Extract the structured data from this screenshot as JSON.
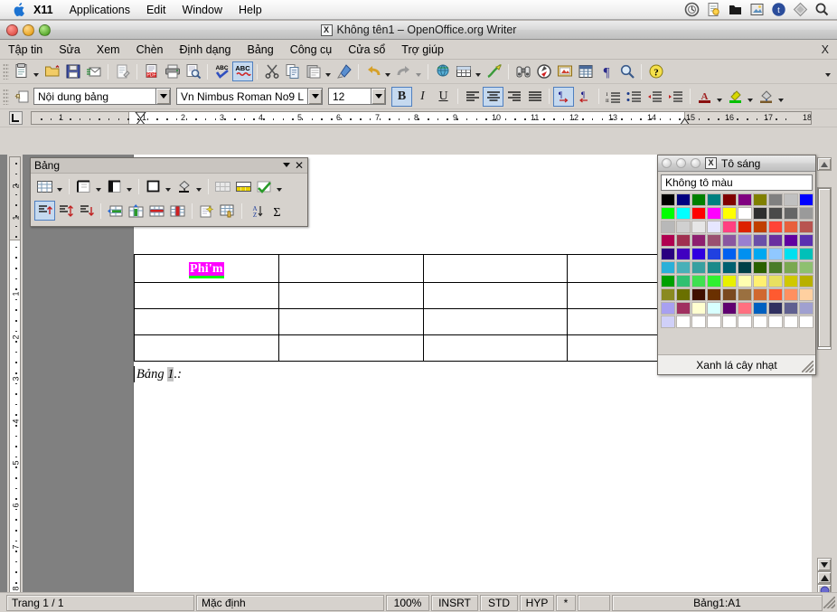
{
  "os_menu": {
    "apple_icon": "apple-logo",
    "items": [
      {
        "label": "X11",
        "bold": true
      },
      {
        "label": "Applications",
        "bold": false
      },
      {
        "label": "Edit",
        "bold": false
      },
      {
        "label": "Window",
        "bold": false
      },
      {
        "label": "Help",
        "bold": false
      }
    ],
    "tray_icons": [
      "timemachine-icon",
      "document-preview-icon",
      "black-folder-icon",
      "screenshot-icon",
      "twitter-icon",
      "diamond-icon",
      "spotlight-icon"
    ]
  },
  "window": {
    "title": "Không tên1 – OpenOffice.org Writer",
    "x_badge": "X",
    "close_label": "X"
  },
  "menubar": {
    "items": [
      {
        "label": "Tập tin",
        "accel": "T"
      },
      {
        "label": "Sửa",
        "accel": "S"
      },
      {
        "label": "Xem",
        "accel": "X"
      },
      {
        "label": "Chèn",
        "accel": "C"
      },
      {
        "label": "Định dạng",
        "accel": "a"
      },
      {
        "label": "Bảng",
        "accel": "g"
      },
      {
        "label": "Công cụ",
        "accel": "C"
      },
      {
        "label": "Cửa sổ",
        "accel": "s"
      },
      {
        "label": "Trợ giúp",
        "accel": "u"
      }
    ]
  },
  "standard_toolbar": {
    "buttons": [
      "new-document-icon",
      "new-dropdown-icon",
      "open-folder-icon",
      "save-icon",
      "email-document-icon",
      "edit-file-icon",
      "export-pdf-icon",
      "print-icon",
      "print-preview-icon",
      "spellcheck-icon",
      "autospellcheck-icon",
      "cut-scissors-icon",
      "copy-icon",
      "paste-icon",
      "paste-dropdown-icon",
      "clone-formatting-brush-icon",
      "undo-icon",
      "undo-dropdown-icon",
      "redo-icon",
      "redo-dropdown-icon",
      "hyperlink-globe-icon",
      "insert-table-icon",
      "insert-table-dropdown-icon",
      "draw-line-icon",
      "find-replace-binoculars-icon",
      "navigator-compass-icon",
      "gallery-picture-icon",
      "data-sources-icon",
      "formatting-marks-pilcrow-icon",
      "zoom-magnifier-icon",
      "help-question-icon",
      "toolbar-overflow-icon"
    ]
  },
  "formatting_toolbar": {
    "style_value": "Nội dung bảng",
    "font_value": "Vn Nimbus Roman No9 L",
    "size_value": "12",
    "apply_style_icon": "apply-style-icon",
    "bold_label": "B",
    "italic_label": "I",
    "underline_label": "U",
    "bold_active": true,
    "align_center_active": true,
    "ltr_active": true,
    "buttons": [
      "align-left-icon",
      "align-center-icon",
      "align-right-icon",
      "justify-icon",
      "ltr-text-direction-icon",
      "rtl-text-direction-icon",
      "ordered-list-icon",
      "unordered-list-icon",
      "decrease-indent-icon",
      "increase-indent-icon",
      "font-color-icon",
      "font-color-dropdown-icon",
      "highlighting-icon",
      "highlighting-dropdown-icon",
      "background-color-icon",
      "background-color-dropdown-icon"
    ]
  },
  "ruler_h": {
    "labels": [
      "1",
      "1",
      "2",
      "3",
      "4",
      "5",
      "6",
      "7",
      "8",
      "9",
      "10",
      "11",
      "12",
      "13",
      "14",
      "15",
      "16",
      "17",
      "18"
    ]
  },
  "ruler_v": {
    "labels": [
      "2",
      "1",
      "1",
      "2",
      "3",
      "4",
      "5",
      "6",
      "7",
      "8"
    ]
  },
  "table_toolbar": {
    "title": "Bảng",
    "dropdown_icon": "chevron-down-icon",
    "close_icon": "close-icon",
    "row1": [
      "insert-table-icon",
      "insert-table-dropdown-icon",
      "line-style-icon",
      "line-style-dropdown-icon",
      "line-color-icon",
      "line-color-dropdown-icon",
      "borders-icon",
      "borders-dropdown-icon",
      "background-color-icon",
      "background-color-dropdown-icon",
      "merge-cells-icon",
      "split-cells-icon",
      "optimize-icon",
      "optimize-dropdown-icon"
    ],
    "row2": [
      "align-top-icon",
      "align-center-vertical-icon",
      "align-bottom-icon",
      "insert-row-icon",
      "insert-column-icon",
      "delete-row-icon",
      "delete-column-icon",
      "autoformat-icon",
      "table-properties-icon",
      "sort-az-icon",
      "sum-sigma-icon"
    ],
    "active_button": "align-top-icon"
  },
  "color_picker": {
    "title": "Tô sáng",
    "x_badge": "X",
    "no_fill_label": "Không tô màu",
    "selected_color_name": "Xanh lá cây nhạt",
    "dots": [
      "minimize-dot",
      "maximize-dot",
      "close-dot"
    ],
    "colors": [
      [
        "#000000",
        "#000080",
        "#008000",
        "#008080",
        "#800000",
        "#800080",
        "#808000",
        "#808080",
        "#c0c0c0",
        "#0000ff"
      ],
      [
        "#00ff00",
        "#00ffff",
        "#ff0000",
        "#ff00ff",
        "#ffff00",
        "#ffffff",
        "#2e2e2e",
        "#4a4a4a",
        "#666666",
        "#9a9a9a"
      ],
      [
        "#b8b8b8",
        "#d0d0d0",
        "#e6e6e6",
        "#e6e6ff",
        "#ff4081",
        "#dd2200",
        "#c04000",
        "#ff4436",
        "#e8603c",
        "#b85450"
      ],
      [
        "#b00050",
        "#a03050",
        "#8e2070",
        "#9a5070",
        "#8a56a0",
        "#9a7fd0",
        "#6a4fa8",
        "#6a2fa0",
        "#6000a0",
        "#5a30b0"
      ],
      [
        "#2a0080",
        "#4000c0",
        "#3000e0",
        "#2040e0",
        "#0060f0",
        "#0090f0",
        "#00a8f0",
        "#90c8ff",
        "#00e0f0",
        "#00c0b8"
      ],
      [
        "#2ab0d8",
        "#48b0b8",
        "#38a0a0",
        "#1a8a8a",
        "#006070",
        "#004048",
        "#2a6000",
        "#4a7c28",
        "#7aa850",
        "#8ec070"
      ],
      [
        "#00a000",
        "#30c070",
        "#40e050",
        "#30f030",
        "#e8f000",
        "#ffffb0",
        "#fff070",
        "#e8e060",
        "#d0c800",
        "#b8b000"
      ],
      [
        "#8a8a20",
        "#6a7000",
        "#401000",
        "#6a3000",
        "#7a4a20",
        "#9a7040",
        "#d06830",
        "#ff5a30",
        "#ff9060",
        "#ffd0a0"
      ],
      [
        "#a8a0f0",
        "#a03060",
        "#ffffd0",
        "#d8ffff",
        "#600070",
        "#ff7080",
        "#0060c0",
        "#303060",
        "#606090",
        "#a0a0d0"
      ],
      [
        "#d0d0f8",
        "#ffffff",
        "#ffffff",
        "#ffffff",
        "#ffffff",
        "#ffffff",
        "#ffffff",
        "#ffffff",
        "#ffffff",
        "#ffffff"
      ]
    ]
  },
  "document": {
    "cell_text": "Phi'm",
    "highlight_color": "#ff00ff",
    "underline_color": "#00ff00",
    "caption_prefix": "Bảng ",
    "caption_number": "1",
    "caption_suffix": ".:"
  },
  "statusbar": {
    "page": "Trang 1 / 1",
    "style": "Mặc định",
    "zoom": "100%",
    "insert_mode": "INSRT",
    "selection_mode": "STD",
    "hyphenation": "HYP",
    "modified": "*",
    "blank": "",
    "cell_ref": "Bảng1:A1"
  }
}
